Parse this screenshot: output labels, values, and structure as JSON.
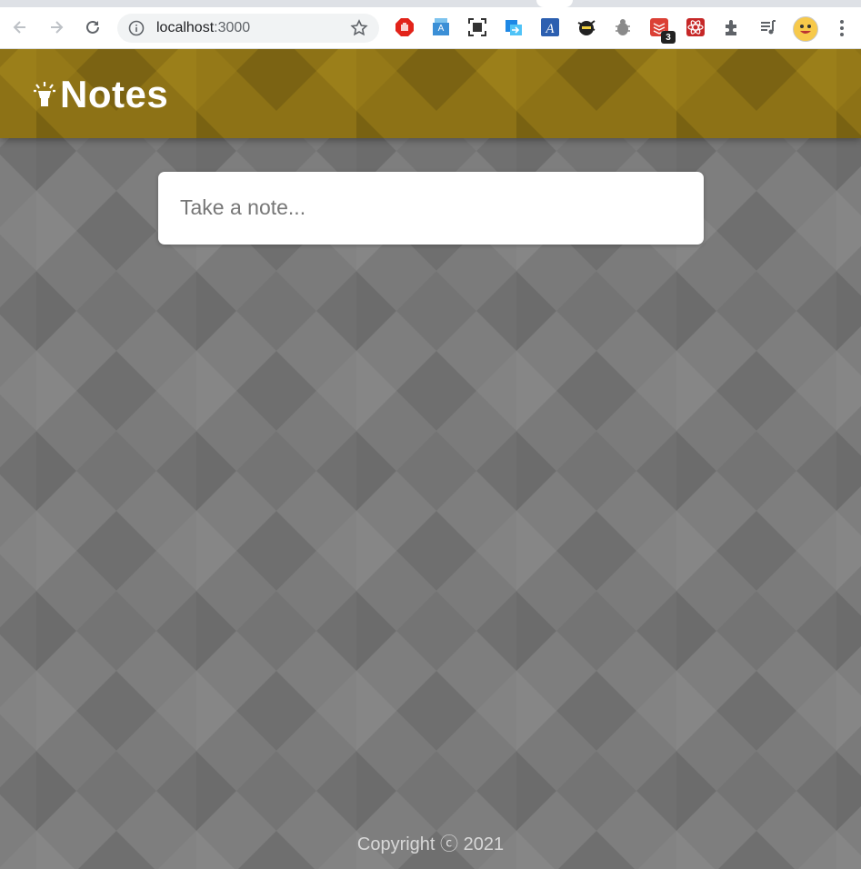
{
  "browser": {
    "url_host": "localhost",
    "url_port": ":3000",
    "extension_badge": "3"
  },
  "app": {
    "title": "Notes",
    "note_input": {
      "placeholder": "Take a note..."
    },
    "footer": "Copyright ⓒ 2021"
  },
  "colors": {
    "header": "#8d7216",
    "background": "#7f7f7f",
    "card": "#ffffff"
  }
}
